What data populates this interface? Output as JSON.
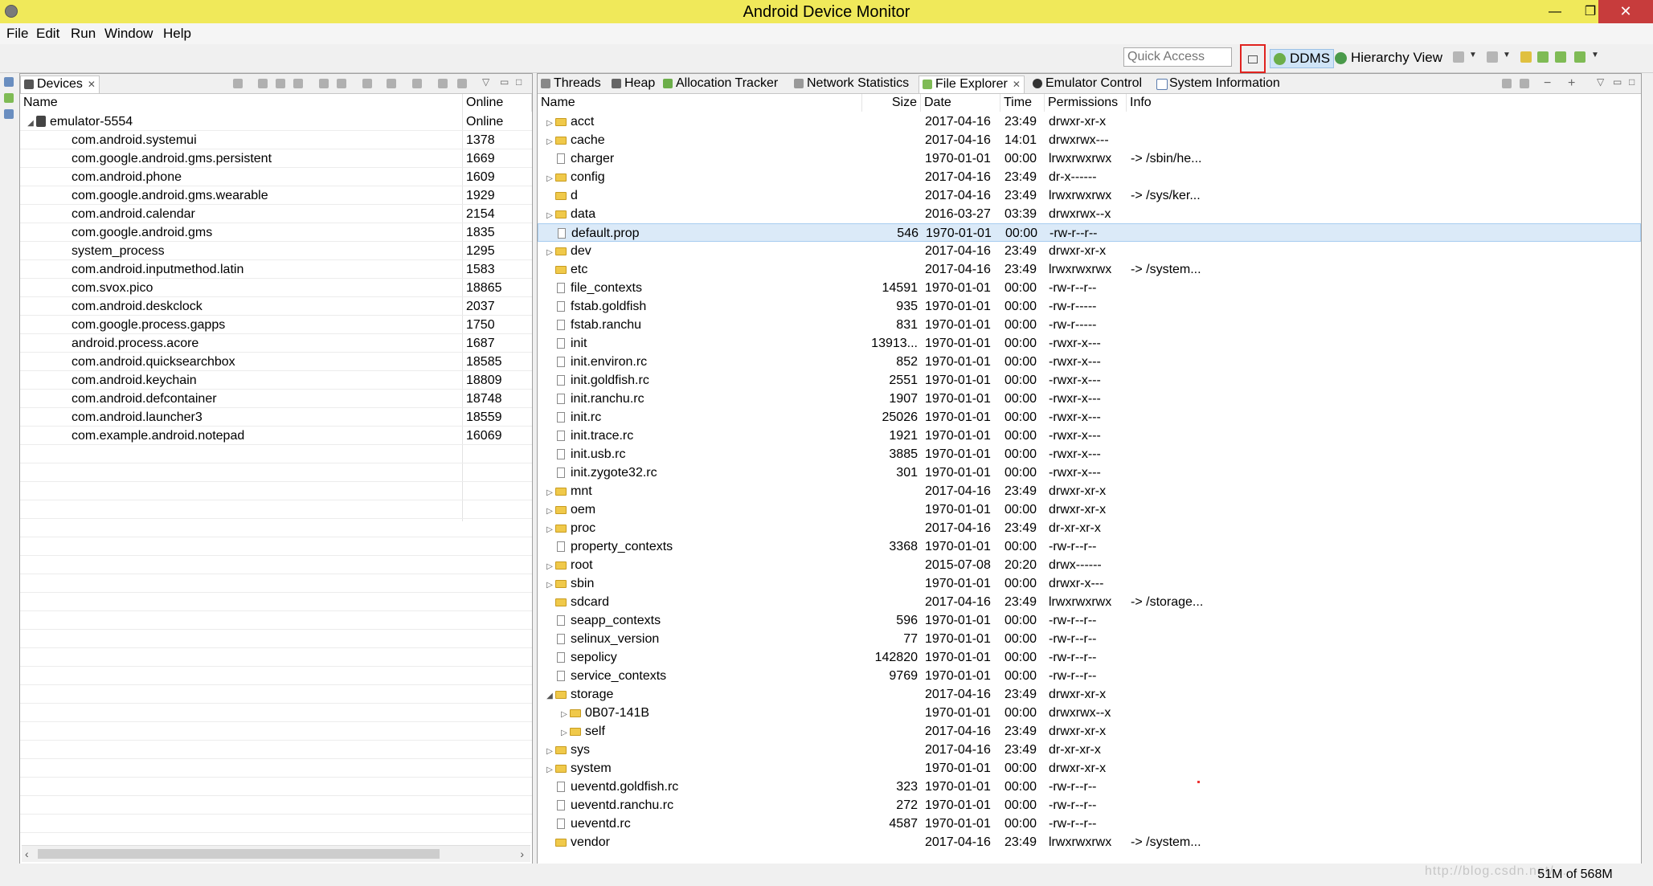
{
  "window": {
    "title": "Android Device Monitor",
    "minimize": "—",
    "maximize": "❐",
    "close": "✕"
  },
  "menu": [
    "File",
    "Edit",
    "Run",
    "Window",
    "Help"
  ],
  "toolbar": {
    "quick_access_placeholder": "Quick Access",
    "perspectives": [
      "DDMS",
      "Hierarchy View"
    ]
  },
  "devices_panel": {
    "tab": "Devices",
    "columns": [
      "Name",
      "Online"
    ],
    "device": {
      "name": "emulator-5554",
      "status": "Online"
    },
    "processes": [
      {
        "name": "com.android.systemui",
        "pid": "1378"
      },
      {
        "name": "com.google.android.gms.persistent",
        "pid": "1669"
      },
      {
        "name": "com.android.phone",
        "pid": "1609"
      },
      {
        "name": "com.google.android.gms.wearable",
        "pid": "1929"
      },
      {
        "name": "com.android.calendar",
        "pid": "2154"
      },
      {
        "name": "com.google.android.gms",
        "pid": "1835"
      },
      {
        "name": "system_process",
        "pid": "1295"
      },
      {
        "name": "com.android.inputmethod.latin",
        "pid": "1583"
      },
      {
        "name": "com.svox.pico",
        "pid": "18865"
      },
      {
        "name": "com.android.deskclock",
        "pid": "2037"
      },
      {
        "name": "com.google.process.gapps",
        "pid": "1750"
      },
      {
        "name": "android.process.acore",
        "pid": "1687"
      },
      {
        "name": "com.android.quicksearchbox",
        "pid": "18585"
      },
      {
        "name": "com.android.keychain",
        "pid": "18809"
      },
      {
        "name": "com.android.defcontainer",
        "pid": "18748"
      },
      {
        "name": "com.android.launcher3",
        "pid": "18559"
      },
      {
        "name": "com.example.android.notepad",
        "pid": "16069"
      }
    ]
  },
  "right_tabs": [
    "Threads",
    "Heap",
    "Allocation Tracker",
    "Network Statistics",
    "File Explorer",
    "Emulator Control",
    "System Information"
  ],
  "file_explorer": {
    "columns": [
      "Name",
      "Size",
      "Date",
      "Time",
      "Permissions",
      "Info"
    ],
    "files": [
      {
        "name": "acct",
        "size": "",
        "date": "2017-04-16",
        "time": "23:49",
        "perm": "drwxr-xr-x",
        "info": "",
        "type": "folder",
        "level": 0,
        "expand": "closed"
      },
      {
        "name": "cache",
        "size": "",
        "date": "2017-04-16",
        "time": "14:01",
        "perm": "drwxrwx---",
        "info": "",
        "type": "folder",
        "level": 0,
        "expand": "closed"
      },
      {
        "name": "charger",
        "size": "",
        "date": "1970-01-01",
        "time": "00:00",
        "perm": "lrwxrwxrwx",
        "info": "-> /sbin/he...",
        "type": "file",
        "level": 0,
        "expand": "none"
      },
      {
        "name": "config",
        "size": "",
        "date": "2017-04-16",
        "time": "23:49",
        "perm": "dr-x------",
        "info": "",
        "type": "folder",
        "level": 0,
        "expand": "closed"
      },
      {
        "name": "d",
        "size": "",
        "date": "2017-04-16",
        "time": "23:49",
        "perm": "lrwxrwxrwx",
        "info": "-> /sys/ker...",
        "type": "folder",
        "level": 0,
        "expand": "none"
      },
      {
        "name": "data",
        "size": "",
        "date": "2016-03-27",
        "time": "03:39",
        "perm": "drwxrwx--x",
        "info": "",
        "type": "folder",
        "level": 0,
        "expand": "closed"
      },
      {
        "name": "default.prop",
        "size": "546",
        "date": "1970-01-01",
        "time": "00:00",
        "perm": "-rw-r--r--",
        "info": "",
        "type": "file",
        "level": 0,
        "expand": "none",
        "selected": true
      },
      {
        "name": "dev",
        "size": "",
        "date": "2017-04-16",
        "time": "23:49",
        "perm": "drwxr-xr-x",
        "info": "",
        "type": "folder",
        "level": 0,
        "expand": "closed"
      },
      {
        "name": "etc",
        "size": "",
        "date": "2017-04-16",
        "time": "23:49",
        "perm": "lrwxrwxrwx",
        "info": "-> /system...",
        "type": "folder",
        "level": 0,
        "expand": "none"
      },
      {
        "name": "file_contexts",
        "size": "14591",
        "date": "1970-01-01",
        "time": "00:00",
        "perm": "-rw-r--r--",
        "info": "",
        "type": "file",
        "level": 0,
        "expand": "none"
      },
      {
        "name": "fstab.goldfish",
        "size": "935",
        "date": "1970-01-01",
        "time": "00:00",
        "perm": "-rw-r-----",
        "info": "",
        "type": "file",
        "level": 0,
        "expand": "none"
      },
      {
        "name": "fstab.ranchu",
        "size": "831",
        "date": "1970-01-01",
        "time": "00:00",
        "perm": "-rw-r-----",
        "info": "",
        "type": "file",
        "level": 0,
        "expand": "none"
      },
      {
        "name": "init",
        "size": "13913...",
        "date": "1970-01-01",
        "time": "00:00",
        "perm": "-rwxr-x---",
        "info": "",
        "type": "file",
        "level": 0,
        "expand": "none"
      },
      {
        "name": "init.environ.rc",
        "size": "852",
        "date": "1970-01-01",
        "time": "00:00",
        "perm": "-rwxr-x---",
        "info": "",
        "type": "file",
        "level": 0,
        "expand": "none"
      },
      {
        "name": "init.goldfish.rc",
        "size": "2551",
        "date": "1970-01-01",
        "time": "00:00",
        "perm": "-rwxr-x---",
        "info": "",
        "type": "file",
        "level": 0,
        "expand": "none"
      },
      {
        "name": "init.ranchu.rc",
        "size": "1907",
        "date": "1970-01-01",
        "time": "00:00",
        "perm": "-rwxr-x---",
        "info": "",
        "type": "file",
        "level": 0,
        "expand": "none"
      },
      {
        "name": "init.rc",
        "size": "25026",
        "date": "1970-01-01",
        "time": "00:00",
        "perm": "-rwxr-x---",
        "info": "",
        "type": "file",
        "level": 0,
        "expand": "none"
      },
      {
        "name": "init.trace.rc",
        "size": "1921",
        "date": "1970-01-01",
        "time": "00:00",
        "perm": "-rwxr-x---",
        "info": "",
        "type": "file",
        "level": 0,
        "expand": "none"
      },
      {
        "name": "init.usb.rc",
        "size": "3885",
        "date": "1970-01-01",
        "time": "00:00",
        "perm": "-rwxr-x---",
        "info": "",
        "type": "file",
        "level": 0,
        "expand": "none"
      },
      {
        "name": "init.zygote32.rc",
        "size": "301",
        "date": "1970-01-01",
        "time": "00:00",
        "perm": "-rwxr-x---",
        "info": "",
        "type": "file",
        "level": 0,
        "expand": "none"
      },
      {
        "name": "mnt",
        "size": "",
        "date": "2017-04-16",
        "time": "23:49",
        "perm": "drwxr-xr-x",
        "info": "",
        "type": "folder",
        "level": 0,
        "expand": "closed"
      },
      {
        "name": "oem",
        "size": "",
        "date": "1970-01-01",
        "time": "00:00",
        "perm": "drwxr-xr-x",
        "info": "",
        "type": "folder",
        "level": 0,
        "expand": "closed"
      },
      {
        "name": "proc",
        "size": "",
        "date": "2017-04-16",
        "time": "23:49",
        "perm": "dr-xr-xr-x",
        "info": "",
        "type": "folder",
        "level": 0,
        "expand": "closed"
      },
      {
        "name": "property_contexts",
        "size": "3368",
        "date": "1970-01-01",
        "time": "00:00",
        "perm": "-rw-r--r--",
        "info": "",
        "type": "file",
        "level": 0,
        "expand": "none"
      },
      {
        "name": "root",
        "size": "",
        "date": "2015-07-08",
        "time": "20:20",
        "perm": "drwx------",
        "info": "",
        "type": "folder",
        "level": 0,
        "expand": "closed"
      },
      {
        "name": "sbin",
        "size": "",
        "date": "1970-01-01",
        "time": "00:00",
        "perm": "drwxr-x---",
        "info": "",
        "type": "folder",
        "level": 0,
        "expand": "closed"
      },
      {
        "name": "sdcard",
        "size": "",
        "date": "2017-04-16",
        "time": "23:49",
        "perm": "lrwxrwxrwx",
        "info": "-> /storage...",
        "type": "folder",
        "level": 0,
        "expand": "none"
      },
      {
        "name": "seapp_contexts",
        "size": "596",
        "date": "1970-01-01",
        "time": "00:00",
        "perm": "-rw-r--r--",
        "info": "",
        "type": "file",
        "level": 0,
        "expand": "none"
      },
      {
        "name": "selinux_version",
        "size": "77",
        "date": "1970-01-01",
        "time": "00:00",
        "perm": "-rw-r--r--",
        "info": "",
        "type": "file",
        "level": 0,
        "expand": "none"
      },
      {
        "name": "sepolicy",
        "size": "142820",
        "date": "1970-01-01",
        "time": "00:00",
        "perm": "-rw-r--r--",
        "info": "",
        "type": "file",
        "level": 0,
        "expand": "none"
      },
      {
        "name": "service_contexts",
        "size": "9769",
        "date": "1970-01-01",
        "time": "00:00",
        "perm": "-rw-r--r--",
        "info": "",
        "type": "file",
        "level": 0,
        "expand": "none"
      },
      {
        "name": "storage",
        "size": "",
        "date": "2017-04-16",
        "time": "23:49",
        "perm": "drwxr-xr-x",
        "info": "",
        "type": "folder",
        "level": 0,
        "expand": "open"
      },
      {
        "name": "0B07-141B",
        "size": "",
        "date": "1970-01-01",
        "time": "00:00",
        "perm": "drwxrwx--x",
        "info": "",
        "type": "folder",
        "level": 1,
        "expand": "closed"
      },
      {
        "name": "self",
        "size": "",
        "date": "2017-04-16",
        "time": "23:49",
        "perm": "drwxr-xr-x",
        "info": "",
        "type": "folder",
        "level": 1,
        "expand": "closed"
      },
      {
        "name": "sys",
        "size": "",
        "date": "2017-04-16",
        "time": "23:49",
        "perm": "dr-xr-xr-x",
        "info": "",
        "type": "folder",
        "level": 0,
        "expand": "closed"
      },
      {
        "name": "system",
        "size": "",
        "date": "1970-01-01",
        "time": "00:00",
        "perm": "drwxr-xr-x",
        "info": "",
        "type": "folder",
        "level": 0,
        "expand": "closed"
      },
      {
        "name": "ueventd.goldfish.rc",
        "size": "323",
        "date": "1970-01-01",
        "time": "00:00",
        "perm": "-rw-r--r--",
        "info": "",
        "type": "file",
        "level": 0,
        "expand": "none"
      },
      {
        "name": "ueventd.ranchu.rc",
        "size": "272",
        "date": "1970-01-01",
        "time": "00:00",
        "perm": "-rw-r--r--",
        "info": "",
        "type": "file",
        "level": 0,
        "expand": "none"
      },
      {
        "name": "ueventd.rc",
        "size": "4587",
        "date": "1970-01-01",
        "time": "00:00",
        "perm": "-rw-r--r--",
        "info": "",
        "type": "file",
        "level": 0,
        "expand": "none"
      },
      {
        "name": "vendor",
        "size": "",
        "date": "2017-04-16",
        "time": "23:49",
        "perm": "lrwxrwxrwx",
        "info": "-> /system...",
        "type": "folder",
        "level": 0,
        "expand": "none"
      }
    ]
  },
  "status": {
    "memory": "51M of 568M",
    "watermark": "http://blog.csdn.net/..."
  },
  "colors": {
    "titlebar": "#f0e95a",
    "selection": "#dbeaf8",
    "highlight_box": "#e0231f"
  }
}
